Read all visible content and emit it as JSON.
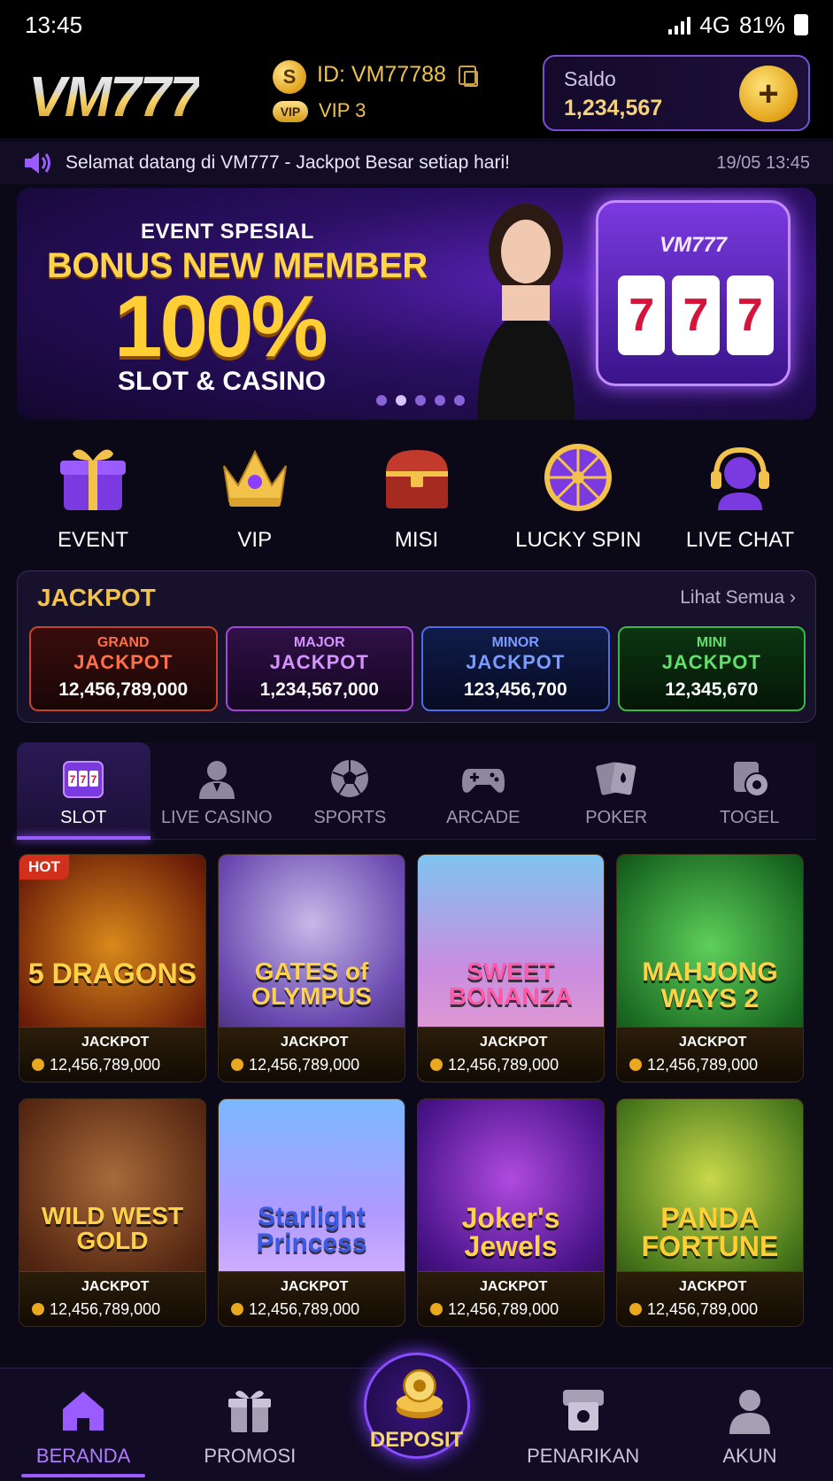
{
  "status_bar": {
    "time": "13:45",
    "network": "4G",
    "battery": "81%"
  },
  "header": {
    "logo": "VM777",
    "user_id": "ID: VM77788",
    "vip_badge": "VIP",
    "vip_level": "VIP 3",
    "saldo_label": "Saldo",
    "saldo_value": "1,234,567",
    "add_label": "+"
  },
  "ticker": {
    "text": "Selamat datang di VM777 - Jackpot Besar setiap hari!",
    "time": "19/05 13:45"
  },
  "banner": {
    "event": "EVENT SPESIAL",
    "title": "BONUS NEW MEMBER",
    "percent": "100%",
    "sub": "SLOT & CASINO",
    "slot_brand": "VM777",
    "reels": [
      "7",
      "7",
      "7"
    ],
    "slides": 5,
    "active_slide": 1
  },
  "quick_menu": [
    {
      "label": "EVENT",
      "icon": "gift-icon"
    },
    {
      "label": "VIP",
      "icon": "crown-icon"
    },
    {
      "label": "MISI",
      "icon": "treasure-chest-icon"
    },
    {
      "label": "LUCKY SPIN",
      "icon": "wheel-icon"
    },
    {
      "label": "LIVE CHAT",
      "icon": "headset-icon"
    }
  ],
  "jackpot": {
    "title": "JACKPOT",
    "more": "Lihat Semua",
    "cards": [
      {
        "tier": "GRAND",
        "word": "JACKPOT",
        "value": "12,456,789,000"
      },
      {
        "tier": "MAJOR",
        "word": "JACKPOT",
        "value": "1,234,567,000"
      },
      {
        "tier": "MINOR",
        "word": "JACKPOT",
        "value": "123,456,700"
      },
      {
        "tier": "MINI",
        "word": "JACKPOT",
        "value": "12,345,670"
      }
    ]
  },
  "categories": [
    {
      "label": "SLOT",
      "icon": "slot-icon",
      "active": true
    },
    {
      "label": "LIVE CASINO",
      "icon": "dealer-icon",
      "active": false
    },
    {
      "label": "SPORTS",
      "icon": "soccer-ball-icon",
      "active": false
    },
    {
      "label": "ARCADE",
      "icon": "gamepad-icon",
      "active": false
    },
    {
      "label": "POKER",
      "icon": "cards-icon",
      "active": false
    },
    {
      "label": "TOGEL",
      "icon": "lottery-icon",
      "active": false
    }
  ],
  "games": [
    {
      "title": "5 DRAGONS",
      "badge": "HOT",
      "jp_label": "JACKPOT",
      "jp_value": "12,456,789,000"
    },
    {
      "title": "GATES of OLYMPUS",
      "badge": "",
      "jp_label": "JACKPOT",
      "jp_value": "12,456,789,000"
    },
    {
      "title": "SWEET BONANZA",
      "badge": "",
      "jp_label": "JACKPOT",
      "jp_value": "12,456,789,000"
    },
    {
      "title": "MAHJONG WAYS 2",
      "badge": "",
      "jp_label": "JACKPOT",
      "jp_value": "12,456,789,000"
    },
    {
      "title": "WILD WEST GOLD",
      "badge": "",
      "jp_label": "JACKPOT",
      "jp_value": "12,456,789,000"
    },
    {
      "title": "Starlight Princess",
      "badge": "",
      "jp_label": "JACKPOT",
      "jp_value": "12,456,789,000"
    },
    {
      "title": "Joker's Jewels",
      "badge": "",
      "jp_label": "JACKPOT",
      "jp_value": "12,456,789,000"
    },
    {
      "title": "PANDA FORTUNE",
      "badge": "",
      "jp_label": "JACKPOT",
      "jp_value": "12,456,789,000"
    }
  ],
  "bottom_nav": [
    {
      "label": "BERANDA",
      "icon": "home-icon",
      "active": true
    },
    {
      "label": "PROMOSI",
      "icon": "gift-icon",
      "active": false
    },
    {
      "label": "DEPOSIT",
      "icon": "coins-icon",
      "active": false
    },
    {
      "label": "PENARIKAN",
      "icon": "atm-icon",
      "active": false
    },
    {
      "label": "AKUN",
      "icon": "user-icon",
      "active": false
    }
  ],
  "colors": {
    "accent": "#9b5cff",
    "gold": "#f3c24a",
    "background": "#0b0818"
  }
}
